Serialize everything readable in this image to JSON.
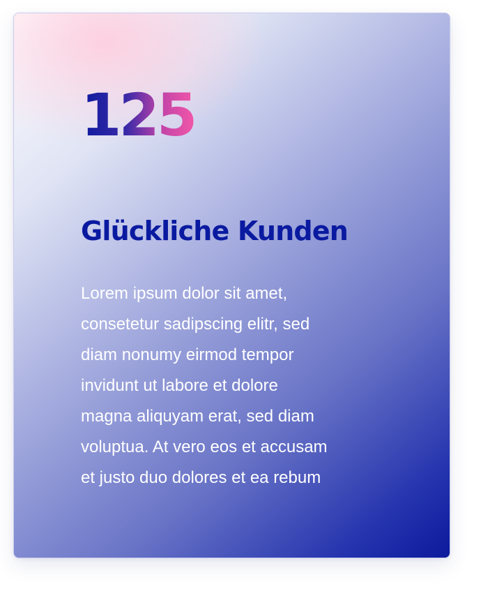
{
  "card": {
    "number": "125",
    "title": "Glückliche Kunden",
    "body_lines": [
      "Lorem ipsum dolor sit amet,",
      "consetetur sadipscing elitr, sed",
      "diam nonumy eirmod tempor",
      "invidunt ut labore et dolore",
      "magna aliquyam erat, sed diam",
      "voluptua. At vero eos et accusam",
      "et justo duo dolores et ea rebum"
    ]
  },
  "colors": {
    "accent_blue": "#0a1aa0",
    "accent_pink": "#f257a8",
    "body_text": "#ffffff"
  }
}
